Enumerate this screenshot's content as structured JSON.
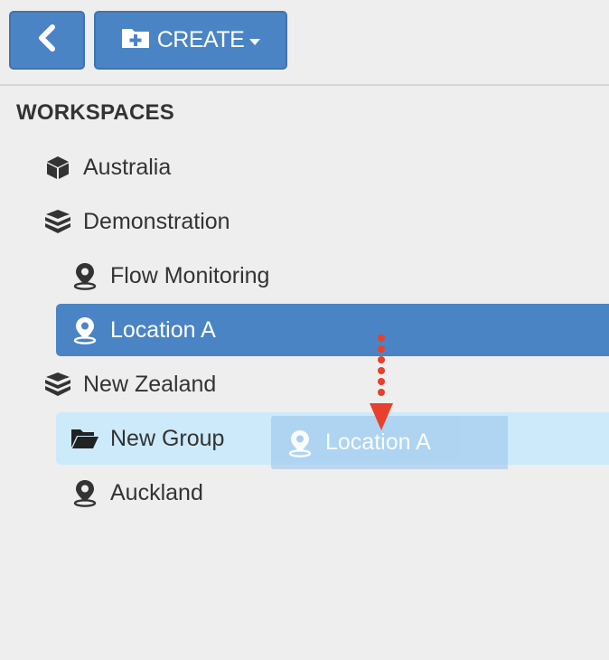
{
  "toolbar": {
    "back_icon": "chevron-left-icon",
    "create_icon": "folder-plus-icon",
    "create_label": "CREATE"
  },
  "sidebar": {
    "heading": "WORKSPACES",
    "items": [
      {
        "label": "Australia",
        "icon": "cube-icon"
      },
      {
        "label": "Demonstration",
        "icon": "cubes-icon"
      },
      {
        "label": "Flow Monitoring",
        "icon": "map-marker-icon"
      },
      {
        "label": "Location A",
        "icon": "map-marker-icon",
        "state": "selected"
      },
      {
        "label": "New Zealand",
        "icon": "cubes-icon"
      },
      {
        "label": "New Group",
        "icon": "folder-open-icon",
        "state": "drop-target"
      },
      {
        "label": "Auckland",
        "icon": "map-marker-icon"
      }
    ]
  },
  "drag": {
    "ghost_label": "Location A",
    "ghost_icon": "map-marker-icon",
    "arrow_color": "#e8402a"
  },
  "colors": {
    "accent": "#4a84c5",
    "drop_highlight": "#cdeafb",
    "background": "#eeeeee"
  }
}
